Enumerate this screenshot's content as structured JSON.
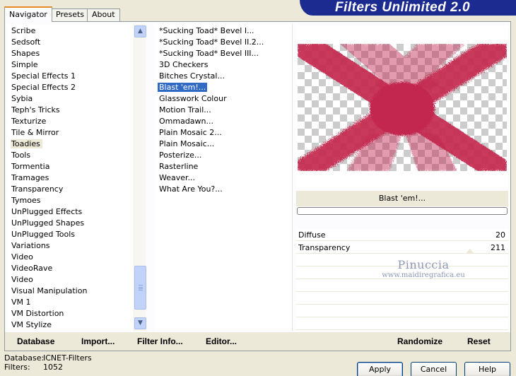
{
  "app": {
    "title": "Filters Unlimited 2.0"
  },
  "tabs": [
    {
      "label": "Navigator",
      "active": true
    },
    {
      "label": "Presets",
      "active": false
    },
    {
      "label": "About",
      "active": false
    }
  ],
  "categories": [
    "Scribe",
    "Sedsoft",
    "Shapes",
    "Simple",
    "Special Effects 1",
    "Special Effects 2",
    "Sybia",
    "Teph's Tricks",
    "Texturize",
    "Tile & Mirror",
    "Toadies",
    "Tools",
    "Tormentia",
    "Tramages",
    "Transparency",
    "Tymoes",
    "UnPlugged Effects",
    "UnPlugged Shapes",
    "UnPlugged Tools",
    "Variations",
    "Video",
    "VideoRave",
    "Video",
    "Visual Manipulation",
    "VM 1",
    "VM Distortion",
    "VM Stylize"
  ],
  "selected_category": "Toadies",
  "filters": [
    "*Sucking Toad*  Bevel I...",
    "*Sucking Toad*  Bevel II.2...",
    "*Sucking Toad*  Bevel III...",
    "3D Checkers",
    "Bitches Crystal...",
    "Blast 'em!...",
    "Glasswork Colour",
    "Motion Trail...",
    "Ommadawn...",
    "Plain Mosaic 2...",
    "Plain Mosaic...",
    "Posterize...",
    "Rasterline",
    "Weaver...",
    "What Are You?..."
  ],
  "selected_filter": "Blast 'em!...",
  "preview": {
    "filter_name": "Blast 'em!...",
    "shape_color": "#c3274f",
    "progress": 0
  },
  "params": [
    {
      "label": "Diffuse",
      "value": "20"
    },
    {
      "label": "Transparency",
      "value": "211"
    }
  ],
  "watermark": {
    "line1": "Pinuccia",
    "line2": "www.maidiregrafica.eu"
  },
  "bottom_buttons": {
    "database": "Database",
    "import": "Import...",
    "filter_info": "Filter Info...",
    "editor": "Editor...",
    "randomize": "Randomize",
    "reset": "Reset"
  },
  "status": {
    "database_label": "Database:",
    "database_value": "ICNET-Filters",
    "filters_label": "Filters:",
    "filters_value": "1052"
  },
  "dialog_buttons": {
    "apply": "Apply",
    "cancel": "Cancel",
    "help": "Help"
  },
  "colors": {
    "accent": "#316ac5",
    "banner": "#1c2b8f",
    "tab_highlight": "#e68b2c"
  }
}
